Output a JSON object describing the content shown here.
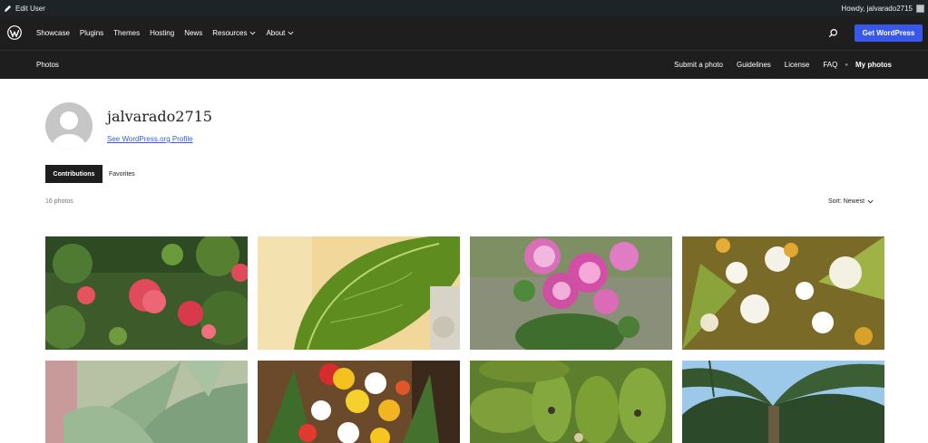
{
  "adminbar": {
    "edit_user": "Edit User",
    "howdy": "Howdy, jalvarado2715"
  },
  "global_nav": {
    "items": [
      {
        "label": "Showcase",
        "dropdown": false
      },
      {
        "label": "Plugins",
        "dropdown": false
      },
      {
        "label": "Themes",
        "dropdown": false
      },
      {
        "label": "Hosting",
        "dropdown": false
      },
      {
        "label": "News",
        "dropdown": false
      },
      {
        "label": "Resources",
        "dropdown": true
      },
      {
        "label": "About",
        "dropdown": true
      }
    ],
    "cta": "Get WordPress",
    "accent": "#3858e9"
  },
  "local_nav": {
    "title": "Photos",
    "menu": [
      "Submit a photo",
      "Guidelines",
      "License",
      "FAQ"
    ],
    "active": "My photos"
  },
  "profile": {
    "username": "jalvarado2715",
    "profile_link": "See WordPress.org Profile"
  },
  "tabs": {
    "contributions": "Contributions",
    "favorites": "Favorites"
  },
  "gallery": {
    "count": "16 photos",
    "sort": "Sort: Newest",
    "photos": [
      "red-ixora-flowers",
      "green-leaf",
      "pink-succulent-flowers",
      "white-flower-bouquet",
      "kalanchoe-leaves",
      "gerbera-bouquet",
      "green-bananas",
      "palm-tree"
    ]
  }
}
